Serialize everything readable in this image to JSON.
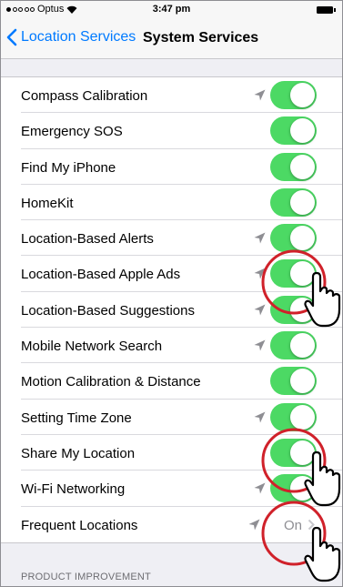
{
  "status_bar": {
    "carrier": "Optus",
    "time": "3:47 pm"
  },
  "nav": {
    "back_label": "Location Services",
    "title": "System Services"
  },
  "rows": [
    {
      "label": "Compass Calibration",
      "arrow": true,
      "toggle": true
    },
    {
      "label": "Emergency SOS",
      "arrow": false,
      "toggle": true
    },
    {
      "label": "Find My iPhone",
      "arrow": false,
      "toggle": true
    },
    {
      "label": "HomeKit",
      "arrow": false,
      "toggle": true
    },
    {
      "label": "Location-Based Alerts",
      "arrow": true,
      "toggle": true
    },
    {
      "label": "Location-Based Apple Ads",
      "arrow": true,
      "toggle": true
    },
    {
      "label": "Location-Based Suggestions",
      "arrow": true,
      "toggle": true
    },
    {
      "label": "Mobile Network Search",
      "arrow": true,
      "toggle": true
    },
    {
      "label": "Motion Calibration & Distance",
      "arrow": false,
      "toggle": true
    },
    {
      "label": "Setting Time Zone",
      "arrow": true,
      "toggle": true
    },
    {
      "label": "Share My Location",
      "arrow": false,
      "toggle": true
    },
    {
      "label": "Wi-Fi Networking",
      "arrow": true,
      "toggle": true
    },
    {
      "label": "Frequent Locations",
      "arrow": true,
      "value": "On"
    }
  ],
  "section_header": "PRODUCT IMPROVEMENT",
  "colors": {
    "tint": "#007aff",
    "toggle_on": "#4cd964",
    "highlight": "#d0212a"
  },
  "icons": {
    "back": "chevron-left-icon",
    "location": "location-arrow-icon",
    "disclosure": "chevron-right-icon",
    "pointer": "hand-pointer-icon"
  }
}
